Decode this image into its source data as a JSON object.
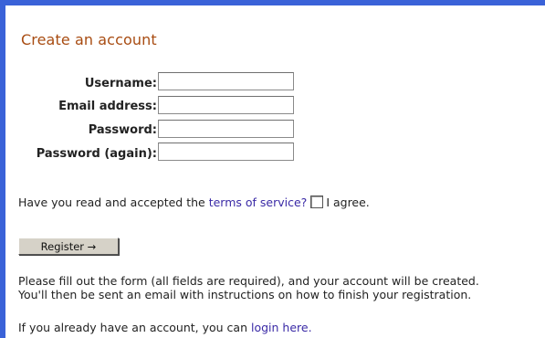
{
  "page": {
    "title": "Create an account"
  },
  "form": {
    "fields": [
      {
        "label": "Username:",
        "value": ""
      },
      {
        "label": "Email address:",
        "value": ""
      },
      {
        "label": "Password:",
        "value": ""
      },
      {
        "label": "Password (again):",
        "value": ""
      }
    ]
  },
  "terms": {
    "prefix": "Have you read and accepted the",
    "link_text": "terms of service?",
    "agree_label": "I agree."
  },
  "register": {
    "label": "Register →"
  },
  "help": {
    "line1": "Please fill out the form (all fields are required), and your account will be created.",
    "line2": "You'll then be sent an email with instructions on how to finish your registration."
  },
  "login": {
    "prefix": "If you already have an account, you can",
    "link_text": "login here."
  },
  "colors": {
    "frame_border": "#3a62d8",
    "title": "#a84c12",
    "link": "#3a2aa6",
    "button_bg": "#d6d2c8"
  }
}
